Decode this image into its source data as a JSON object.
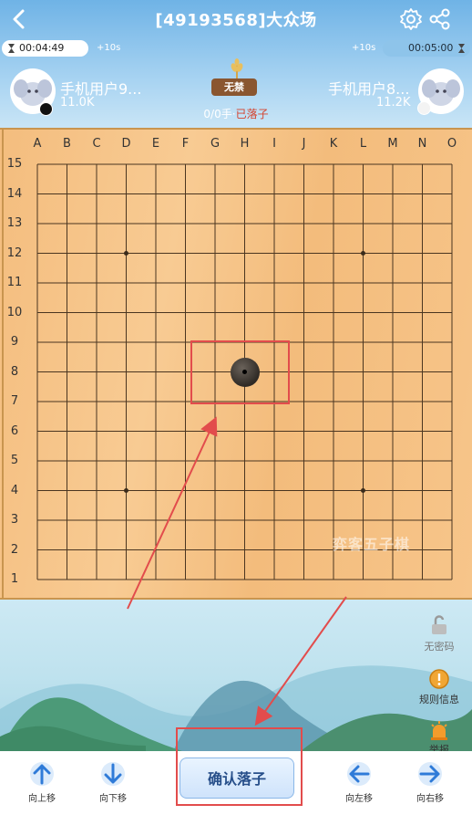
{
  "header": {
    "title": "[49193568]大众场"
  },
  "timers": {
    "left_time": "00:04:49",
    "left_increment": "+10s",
    "right_increment": "+10s",
    "right_time": "00:05:00"
  },
  "players": {
    "left": {
      "name": "手机用户9...",
      "rating": "11.0K",
      "stone": "black"
    },
    "right": {
      "name": "手机用户8...",
      "rating": "11.2K",
      "stone": "white"
    }
  },
  "match": {
    "rule_badge": "无禁",
    "moves_text": "0/0手·",
    "status_text": "已落子"
  },
  "board": {
    "columns": [
      "A",
      "B",
      "C",
      "D",
      "E",
      "F",
      "G",
      "H",
      "I",
      "J",
      "K",
      "L",
      "M",
      "N",
      "O"
    ],
    "rows": [
      "15",
      "14",
      "13",
      "12",
      "11",
      "10",
      "9",
      "8",
      "7",
      "6",
      "5",
      "4",
      "3",
      "2",
      "1"
    ],
    "stones": [
      {
        "coord": "H8",
        "color": "black"
      }
    ],
    "star_points": [
      "D12",
      "L12",
      "D4",
      "L4"
    ],
    "watermark": "弈客五子棋"
  },
  "side_tools": {
    "no_password": "无密码",
    "rules_info": "规则信息",
    "report": "举报"
  },
  "bottom_nav": {
    "move_up": "向上移",
    "move_down": "向下移",
    "confirm": "确认落子",
    "move_left": "向左移",
    "move_right": "向右移"
  },
  "colors": {
    "annotation_red": "#e24c4c",
    "board_wood": "#f6c287",
    "accent_blue": "#4a90d9"
  }
}
